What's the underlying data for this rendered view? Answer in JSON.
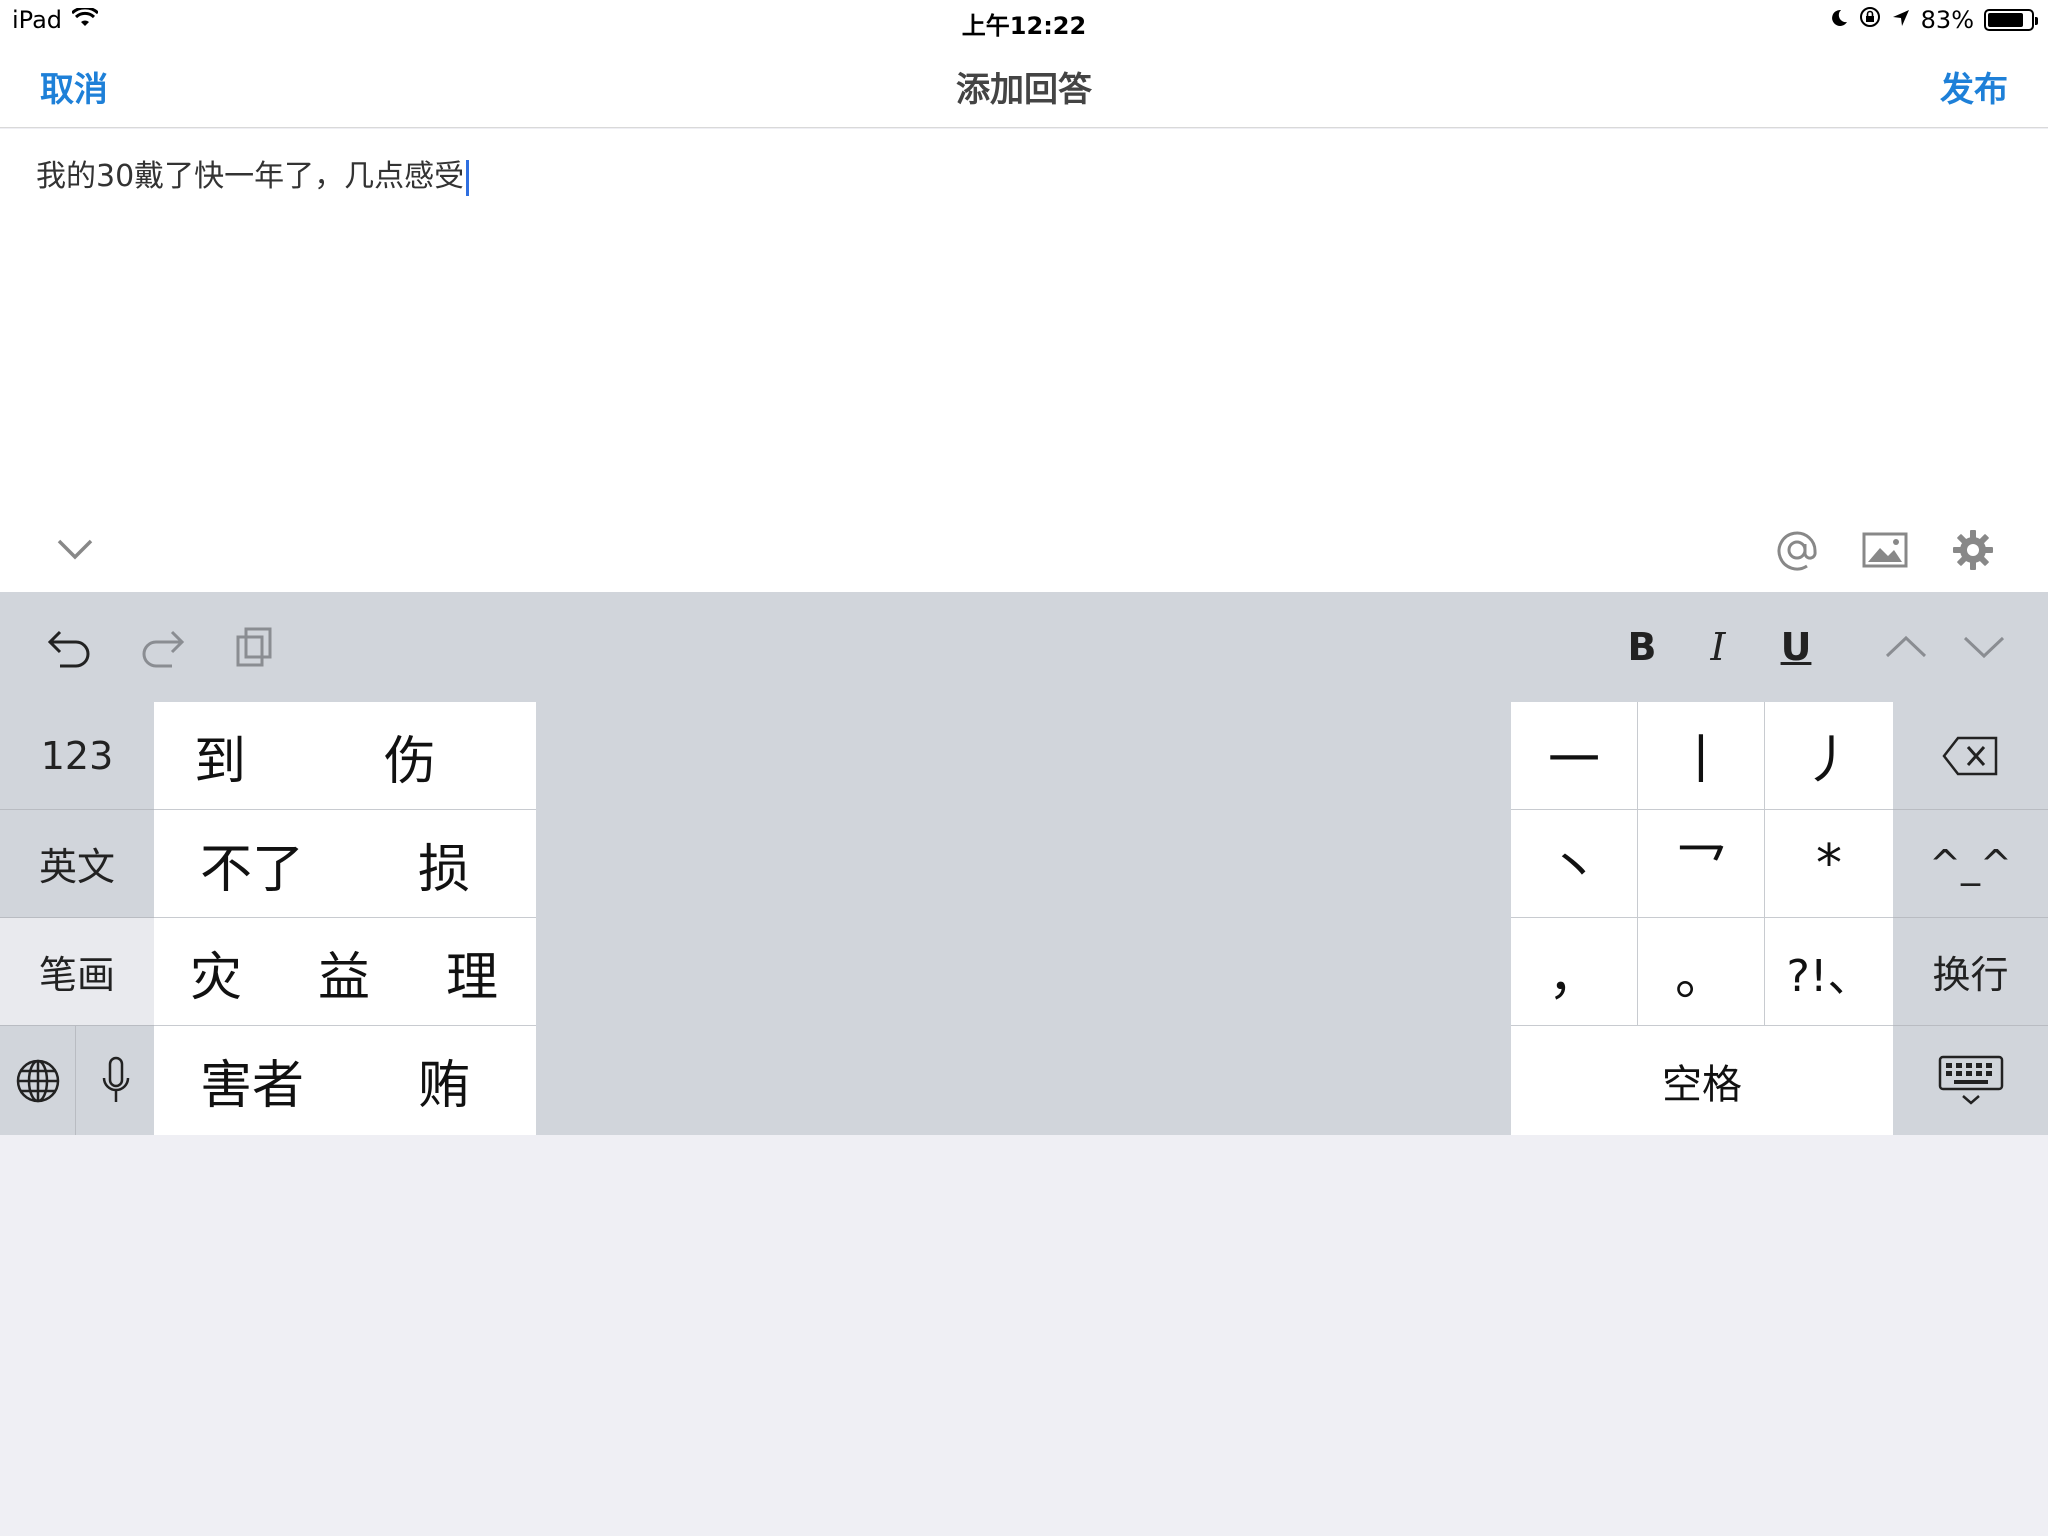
{
  "status_bar": {
    "device": "iPad",
    "time": "上午12:22",
    "battery": "83%",
    "battery_level": 0.83
  },
  "nav": {
    "cancel": "取消",
    "title": "添加回答",
    "publish": "发布"
  },
  "editor": {
    "text": "我的30戴了快一年了，几点感受"
  },
  "format_toolbar": {
    "bold": "B",
    "italic": "I",
    "underline": "U"
  },
  "keyboard": {
    "side_keys": [
      "123",
      "英文",
      "笔画"
    ],
    "candidates": [
      [
        "到",
        "伤"
      ],
      [
        "不了",
        "损"
      ],
      [
        "灾",
        "益",
        "理"
      ],
      [
        "害者",
        "贿"
      ]
    ],
    "stroke_keys": [
      [
        "一",
        "丨",
        "丿"
      ],
      [
        "丶",
        "乛",
        "*"
      ],
      [
        "，",
        "。",
        "?!、"
      ]
    ],
    "space": "空格",
    "emoticon": "^_^",
    "return": "换行"
  }
}
